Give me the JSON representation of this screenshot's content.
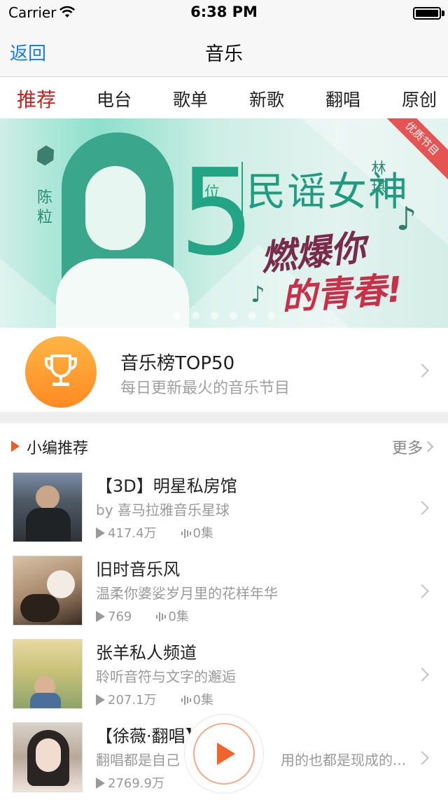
{
  "status_bar": {
    "carrier": "Carrier",
    "time": "6:38 PM"
  },
  "nav": {
    "back_label": "返回",
    "title": "音乐"
  },
  "tabs": [
    {
      "label": "推荐",
      "active": true
    },
    {
      "label": "电台"
    },
    {
      "label": "歌单"
    },
    {
      "label": "新歌"
    },
    {
      "label": "翻唱"
    },
    {
      "label": "原创"
    }
  ],
  "banner": {
    "ribbon": "优质节目",
    "name": "陈粒",
    "number": "5",
    "unit": "位",
    "headline": "民谣女神",
    "side_name": "林琪",
    "slogan_line1": "燃爆你",
    "slogan_line2": "的青春!",
    "page_count": 6,
    "active_page": 1
  },
  "top50": {
    "title": "音乐榜TOP50",
    "subtitle": "每日更新最火的音乐节目"
  },
  "section": {
    "title": "小编推荐",
    "more": "更多"
  },
  "items": [
    {
      "title": "【3D】明星私房馆",
      "subtitle": "by 喜马拉雅音乐星球",
      "plays": "417.4万",
      "episodes": "0集"
    },
    {
      "title": "旧时音乐风",
      "subtitle": "温柔你婆娑岁月里的花样年华",
      "plays": "769",
      "episodes": "0集"
    },
    {
      "title": "张羊私人频道",
      "subtitle": "聆听音符与文字的邂逅",
      "plays": "207.1万",
      "episodes": "0集"
    },
    {
      "title": "【徐薇·翻唱】",
      "subtitle": "翻唱都是自己",
      "subtitle_tail": "用的也都是现成的...",
      "plays": "2769.9万"
    }
  ],
  "colors": {
    "accent": "#c8211c",
    "link": "#1a7ee0",
    "orange": "#f0632b"
  }
}
